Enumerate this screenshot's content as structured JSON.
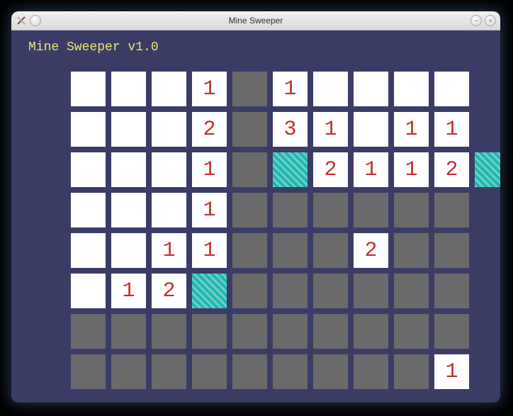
{
  "window": {
    "title": "Mine Sweeper",
    "app_icon": "app-icon",
    "controls": {
      "minimize": "−",
      "close": "×"
    }
  },
  "game": {
    "version_label": "Mine Sweeper v1.0",
    "rows": 8,
    "cols": 10,
    "board": [
      [
        "o:",
        "o:",
        "o:",
        "o:1",
        "c",
        "o:1",
        "o:",
        "o:",
        "o:",
        "o:"
      ],
      [
        "o:",
        "o:",
        "o:",
        "o:2",
        "c",
        "o:3",
        "o:1",
        "o:",
        "o:1",
        "o:1"
      ],
      [
        "o:",
        "o:",
        "o:",
        "o:1",
        "c",
        "f",
        "o:2",
        "o:1",
        "o:1",
        "o:2",
        "f"
      ],
      [
        "o:",
        "o:",
        "o:",
        "o:1",
        "c",
        "c",
        "c",
        "c",
        "c",
        "c"
      ],
      [
        "o:",
        "o:",
        "o:1",
        "o:1",
        "c",
        "c",
        "c",
        "o:2",
        "c",
        "c"
      ],
      [
        "o:",
        "o:1",
        "o:2",
        "f",
        "c",
        "c",
        "c",
        "c",
        "c",
        "c"
      ],
      [
        "c",
        "c",
        "c",
        "c",
        "c",
        "c",
        "c",
        "c",
        "c",
        "c"
      ],
      [
        "c",
        "c",
        "c",
        "c",
        "c",
        "c",
        "c",
        "c",
        "c",
        "o:1"
      ]
    ],
    "_board_fixed": [
      [
        {
          "s": "open",
          "v": ""
        },
        {
          "s": "open",
          "v": ""
        },
        {
          "s": "open",
          "v": ""
        },
        {
          "s": "open",
          "v": "1"
        },
        {
          "s": "covered",
          "v": ""
        },
        {
          "s": "open",
          "v": "1"
        },
        {
          "s": "open",
          "v": ""
        },
        {
          "s": "open",
          "v": ""
        },
        {
          "s": "open",
          "v": ""
        },
        {
          "s": "open",
          "v": ""
        }
      ],
      [
        {
          "s": "open",
          "v": ""
        },
        {
          "s": "open",
          "v": ""
        },
        {
          "s": "open",
          "v": ""
        },
        {
          "s": "open",
          "v": "2"
        },
        {
          "s": "covered",
          "v": ""
        },
        {
          "s": "open",
          "v": "3"
        },
        {
          "s": "open",
          "v": "1"
        },
        {
          "s": "open",
          "v": ""
        },
        {
          "s": "open",
          "v": "1"
        },
        {
          "s": "open",
          "v": "1"
        }
      ],
      [
        {
          "s": "open",
          "v": ""
        },
        {
          "s": "open",
          "v": ""
        },
        {
          "s": "open",
          "v": ""
        },
        {
          "s": "open",
          "v": "1"
        },
        {
          "s": "covered",
          "v": ""
        },
        {
          "s": "flag",
          "v": ""
        },
        {
          "s": "open",
          "v": "2"
        },
        {
          "s": "open",
          "v": "1"
        },
        {
          "s": "open",
          "v": "1"
        },
        {
          "s": "open",
          "v": "2"
        }
      ],
      [
        {
          "s": "open",
          "v": ""
        },
        {
          "s": "open",
          "v": ""
        },
        {
          "s": "open",
          "v": ""
        },
        {
          "s": "open",
          "v": "1"
        },
        {
          "s": "covered",
          "v": ""
        },
        {
          "s": "covered",
          "v": ""
        },
        {
          "s": "covered",
          "v": ""
        },
        {
          "s": "covered",
          "v": ""
        },
        {
          "s": "covered",
          "v": ""
        },
        {
          "s": "covered",
          "v": ""
        }
      ],
      [
        {
          "s": "open",
          "v": ""
        },
        {
          "s": "open",
          "v": ""
        },
        {
          "s": "open",
          "v": "1"
        },
        {
          "s": "open",
          "v": "1"
        },
        {
          "s": "covered",
          "v": ""
        },
        {
          "s": "covered",
          "v": ""
        },
        {
          "s": "covered",
          "v": ""
        },
        {
          "s": "open",
          "v": "2"
        },
        {
          "s": "covered",
          "v": ""
        },
        {
          "s": "covered",
          "v": ""
        }
      ],
      [
        {
          "s": "open",
          "v": ""
        },
        {
          "s": "open",
          "v": "1"
        },
        {
          "s": "open",
          "v": "2"
        },
        {
          "s": "flag",
          "v": ""
        },
        {
          "s": "covered",
          "v": ""
        },
        {
          "s": "covered",
          "v": ""
        },
        {
          "s": "covered",
          "v": ""
        },
        {
          "s": "covered",
          "v": ""
        },
        {
          "s": "covered",
          "v": ""
        },
        {
          "s": "covered",
          "v": ""
        }
      ],
      [
        {
          "s": "covered",
          "v": ""
        },
        {
          "s": "covered",
          "v": ""
        },
        {
          "s": "covered",
          "v": ""
        },
        {
          "s": "covered",
          "v": ""
        },
        {
          "s": "covered",
          "v": ""
        },
        {
          "s": "covered",
          "v": ""
        },
        {
          "s": "covered",
          "v": ""
        },
        {
          "s": "covered",
          "v": ""
        },
        {
          "s": "covered",
          "v": ""
        },
        {
          "s": "covered",
          "v": ""
        }
      ],
      [
        {
          "s": "covered",
          "v": ""
        },
        {
          "s": "covered",
          "v": ""
        },
        {
          "s": "covered",
          "v": ""
        },
        {
          "s": "covered",
          "v": ""
        },
        {
          "s": "covered",
          "v": ""
        },
        {
          "s": "covered",
          "v": ""
        },
        {
          "s": "covered",
          "v": ""
        },
        {
          "s": "covered",
          "v": ""
        },
        {
          "s": "covered",
          "v": ""
        },
        {
          "s": "open",
          "v": "1"
        }
      ]
    ],
    "extra_flag_row2": {
      "row": 2,
      "col": 10,
      "s": "flag",
      "v": ""
    }
  },
  "colors": {
    "window_bg": "#3b3c66",
    "covered": "#6a6a6a",
    "open": "#ffffff",
    "flag": "#1fb6ad",
    "number": "#c23030",
    "version": "#e9e96a"
  }
}
